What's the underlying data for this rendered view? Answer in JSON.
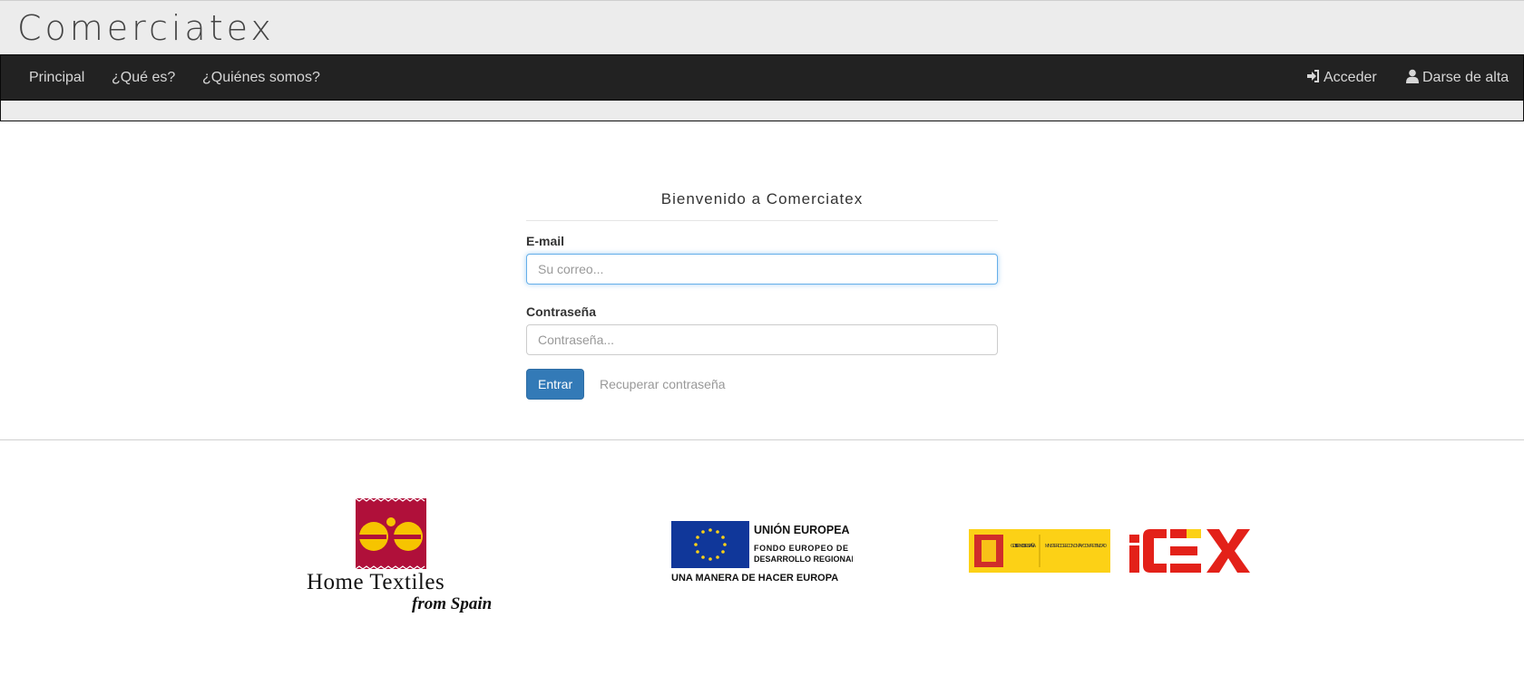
{
  "brand": {
    "title": "Comerciatex"
  },
  "nav": {
    "left": [
      {
        "label": "Principal"
      },
      {
        "label": "¿Qué es?"
      },
      {
        "label": "¿Quiénes somos?"
      }
    ],
    "right": [
      {
        "label": "Acceder",
        "icon": "sign-in-icon"
      },
      {
        "label": "Darse de alta",
        "icon": "user-icon"
      }
    ]
  },
  "login": {
    "title": "Bienvenido a Comerciatex",
    "email_label": "E-mail",
    "email_placeholder": "Su correo...",
    "email_value": "",
    "password_label": "Contraseña",
    "password_placeholder": "Contraseña...",
    "password_value": "",
    "submit_label": "Entrar",
    "recover_label": "Recuperar contraseña"
  },
  "logos": {
    "home_textiles": {
      "line1": "Home Textiles",
      "line2": "from Spain"
    },
    "eu": {
      "title": "UNIÓN EUROPEA",
      "line1": "FONDO EUROPEO DE",
      "line2": "DESARROLLO REGIONAL",
      "motto": "UNA MANERA DE HACER EUROPA"
    },
    "spain": {
      "gov": "GOBIERNO DE ESPAÑA",
      "ministry": "MINISTERIO DE ECONOMÍA Y COMPETITIVIDAD",
      "icex": "ICEX"
    }
  },
  "colors": {
    "nav_bg": "#222222",
    "primary": "#337ab7",
    "icex_red": "#e32119",
    "eu_blue": "#10379a",
    "spain_yellow": "#fcd116"
  }
}
